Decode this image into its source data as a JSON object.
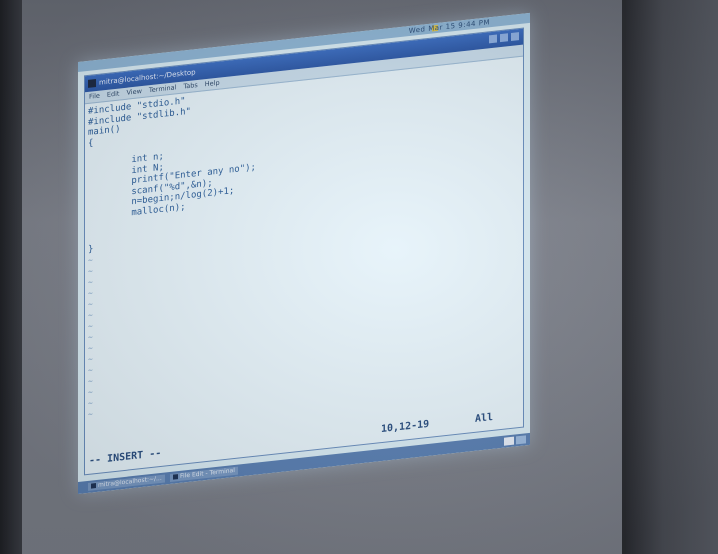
{
  "colors": {
    "terminal_bg": "#e6f3fa",
    "code_text": "#2c5f9b",
    "titlebar": "#2d59a8",
    "taskbar": "#5a80b4"
  },
  "top_panel": {
    "clock": "Wed Mar 15 9:44 PM"
  },
  "window": {
    "icon_glyph": "",
    "title": "mitra@localhost:~/Desktop",
    "title_right": "",
    "menu": [
      "File",
      "Edit",
      "View",
      "Terminal",
      "Tabs",
      "Help"
    ]
  },
  "editor": {
    "lines": [
      "#include \"stdio.h\"",
      "#include \"stdlib.h\"",
      "main()",
      "{",
      "",
      "        int n;",
      "        int N;",
      "        printf(\"Enter any no\");",
      "        scanf(\"%d\",&n);",
      "        n=begin;n/log(2)+1;",
      "        malloc(n);",
      "",
      "",
      "}"
    ],
    "empty_line_marker": "~"
  },
  "statusline": {
    "mode": "-- INSERT --",
    "position": "10,12-19",
    "percent": "All"
  },
  "taskbar": {
    "items": [
      {
        "icon": "terminal-icon",
        "label": "mitra@localhost:~/..."
      },
      {
        "icon": "terminal-icon",
        "label": "File Edit - Terminal"
      }
    ]
  }
}
